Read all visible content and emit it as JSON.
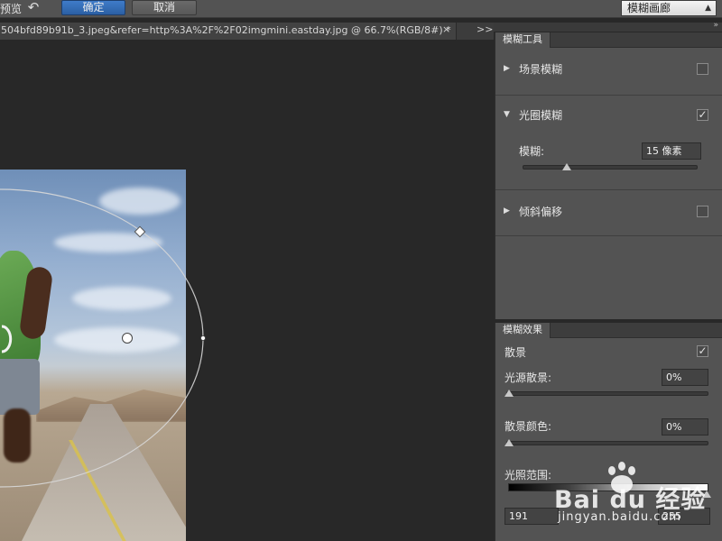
{
  "toolbar": {
    "mode_label": "预览",
    "ok_label": "确定",
    "cancel_label": "取消",
    "blur_dropdown_value": "模糊画廊"
  },
  "document": {
    "tab_title": "504bfd89b91b_3.jpeg&refer=http%3A%2F%2F02imgmini.eastday.jpg @ 66.7%(RGB/8#) *",
    "close_glyph": "×",
    "more_glyph": ">>"
  },
  "blur_tools": {
    "panel_title": "模糊工具",
    "sections": [
      {
        "title": "场景模糊",
        "expanded": false,
        "checked": false
      },
      {
        "title": "光圈模糊",
        "expanded": true,
        "checked": true
      },
      {
        "title": "倾斜偏移",
        "expanded": false,
        "checked": false
      }
    ],
    "blur_label": "模糊:",
    "blur_value": "15 像素",
    "blur_slider_fraction": 0.25
  },
  "blur_effects": {
    "panel_title": "模糊效果",
    "bokeh_label": "散景",
    "bokeh_checked": true,
    "light_bokeh_label": "光源散景:",
    "light_bokeh_value": "0%",
    "bokeh_color_label": "散景颜色:",
    "bokeh_color_value": "0%",
    "light_range_label": "光照范围:",
    "light_range_low": "191",
    "light_range_high": "255"
  },
  "watermark": {
    "brand": "Bai du 经验",
    "url": "jingyan.baidu.com"
  },
  "colors": {
    "accent": "#2f67b1",
    "panel_bg": "#535353",
    "canvas_bg": "#282828"
  }
}
